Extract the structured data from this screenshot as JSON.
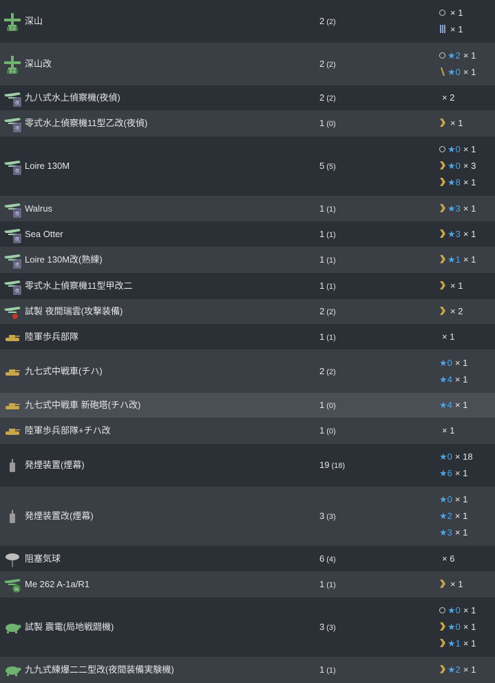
{
  "colors": {
    "star": "#4ea6e6",
    "row_odd": "#3a3e45",
    "row_even": "#2b2f36",
    "chevron": "#c8a64a",
    "plane_green": "#6fb36f"
  },
  "rows": [
    {
      "name": "深山",
      "count": "2",
      "sub": "(2)",
      "icon": "heavy-bomber-icon",
      "improvements": [
        {
          "prof": "circle",
          "star": "",
          "mult": "× 1"
        },
        {
          "prof": "bars3-prof",
          "star": "",
          "mult": "× 1"
        }
      ]
    },
    {
      "name": "深山改",
      "count": "2",
      "sub": "(2)",
      "icon": "heavy-bomber-icon",
      "improvements": [
        {
          "prof": "circle",
          "star": "★2",
          "mult": "× 1"
        },
        {
          "prof": "slash-prof",
          "star": "★0",
          "mult": "× 1"
        }
      ]
    },
    {
      "name": "九八式水上偵察機(夜偵)",
      "count": "2",
      "sub": "(2)",
      "icon": "night-seaplane-icon",
      "improvements": [
        {
          "prof": "",
          "star": "",
          "mult": "× 2"
        }
      ]
    },
    {
      "name": "零式水上偵察機11型乙改(夜偵)",
      "count": "1",
      "sub": "(0)",
      "icon": "night-seaplane-icon",
      "improvements": [
        {
          "prof": "chevron-prof",
          "star": "",
          "mult": "× 1"
        }
      ]
    },
    {
      "name": "Loire 130M",
      "count": "5",
      "sub": "(5)",
      "icon": "night-seaplane-icon",
      "improvements": [
        {
          "prof": "circle",
          "star": "★0",
          "mult": "× 1"
        },
        {
          "prof": "chevron-prof",
          "star": "★0",
          "mult": "× 3"
        },
        {
          "prof": "chevron-prof",
          "star": "★8",
          "mult": "× 1"
        }
      ]
    },
    {
      "name": "Walrus",
      "count": "1",
      "sub": "(1)",
      "icon": "night-seaplane-icon",
      "improvements": [
        {
          "prof": "chevron-prof",
          "star": "★3",
          "mult": "× 1"
        }
      ]
    },
    {
      "name": "Sea Otter",
      "count": "1",
      "sub": "(1)",
      "icon": "night-seaplane-icon",
      "improvements": [
        {
          "prof": "chevron-prof",
          "star": "★3",
          "mult": "× 1"
        }
      ]
    },
    {
      "name": "Loire 130M改(熟練)",
      "count": "1",
      "sub": "(1)",
      "icon": "night-seaplane-icon",
      "improvements": [
        {
          "prof": "chevron-prof",
          "star": "★1",
          "mult": "× 1"
        }
      ]
    },
    {
      "name": "零式水上偵察機11型甲改二",
      "count": "1",
      "sub": "(1)",
      "icon": "night-seaplane-icon",
      "improvements": [
        {
          "prof": "chevron-prof",
          "star": "",
          "mult": "× 1"
        }
      ]
    },
    {
      "name": "試製 夜間瑞雲(攻撃装備)",
      "count": "2",
      "sub": "(2)",
      "icon": "seaplane-bomber-icon",
      "improvements": [
        {
          "prof": "chevron-prof",
          "star": "",
          "mult": "× 2"
        }
      ]
    },
    {
      "name": "陸軍歩兵部隊",
      "count": "1",
      "sub": "(1)",
      "icon": "tank-icon",
      "improvements": [
        {
          "prof": "",
          "star": "",
          "mult": "× 1"
        }
      ]
    },
    {
      "name": "九七式中戦車(チハ)",
      "count": "2",
      "sub": "(2)",
      "icon": "tank-icon",
      "improvements": [
        {
          "prof": "",
          "star": "★0",
          "mult": "× 1"
        },
        {
          "prof": "",
          "star": "★4",
          "mult": "× 1"
        }
      ]
    },
    {
      "name": "九七式中戦車 新砲塔(チハ改)",
      "count": "1",
      "sub": "(0)",
      "icon": "tank-icon",
      "improvements": [
        {
          "prof": "",
          "star": "★4",
          "mult": "× 1"
        }
      ]
    },
    {
      "name": "陸軍歩兵部隊+チハ改",
      "count": "1",
      "sub": "(0)",
      "icon": "tank-icon",
      "improvements": [
        {
          "prof": "",
          "star": "",
          "mult": "× 1"
        }
      ]
    },
    {
      "name": "発煙装置(煙幕)",
      "count": "19",
      "sub": "(18)",
      "icon": "smoke-canister-icon",
      "improvements": [
        {
          "prof": "",
          "star": "★0",
          "mult": "× 18"
        },
        {
          "prof": "",
          "star": "★6",
          "mult": "× 1"
        }
      ]
    },
    {
      "name": "発煙装置改(煙幕)",
      "count": "3",
      "sub": "(3)",
      "icon": "smoke-canister-icon",
      "improvements": [
        {
          "prof": "",
          "star": "★0",
          "mult": "× 1"
        },
        {
          "prof": "",
          "star": "★2",
          "mult": "× 1"
        },
        {
          "prof": "",
          "star": "★3",
          "mult": "× 1"
        }
      ]
    },
    {
      "name": "阻塞気球",
      "count": "6",
      "sub": "(4)",
      "icon": "balloon-icon",
      "improvements": [
        {
          "prof": "",
          "star": "",
          "mult": "× 6"
        }
      ]
    },
    {
      "name": "Me 262 A-1a/R1",
      "count": "1",
      "sub": "(1)",
      "icon": "land-fighter-icon",
      "improvements": [
        {
          "prof": "chevron-prof",
          "star": "",
          "mult": "× 1"
        }
      ]
    },
    {
      "name": "試製 震電(局地戦闘機)",
      "count": "3",
      "sub": "(3)",
      "icon": "turtle-fighter-icon",
      "improvements": [
        {
          "prof": "circle",
          "star": "★0",
          "mult": "× 1"
        },
        {
          "prof": "chevron-prof",
          "star": "★0",
          "mult": "× 1"
        },
        {
          "prof": "chevron-prof",
          "star": "★1",
          "mult": "× 1"
        }
      ]
    },
    {
      "name": "九九式練爆二二型改(夜間装備実験機)",
      "count": "1",
      "sub": "(1)",
      "icon": "turtle-fighter-icon",
      "improvements": [
        {
          "prof": "chevron-prof",
          "star": "★2",
          "mult": "× 1"
        }
      ]
    }
  ]
}
